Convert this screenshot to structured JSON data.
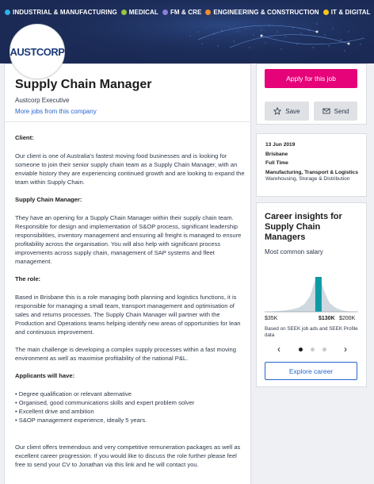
{
  "banner": {
    "sectors": [
      {
        "label": "INDUSTRIAL & MANUFACTURING",
        "color": "#2bb3e6"
      },
      {
        "label": "MEDICAL",
        "color": "#9bc53d"
      },
      {
        "label": "FM & CRE",
        "color": "#8a7fd6"
      },
      {
        "label": "ENGINEERING & CONSTRUCTION",
        "color": "#f28c28"
      },
      {
        "label": "IT & DIGITAL",
        "color": "#f7c51b"
      }
    ]
  },
  "job": {
    "logo_text": "AUSTCORP",
    "title": "Supply Chain Manager",
    "company": "Austcorp Executive",
    "more_jobs": "More jobs from this company"
  },
  "description": {
    "client_heading": "Client:",
    "client_text": "Our client is one of Australia's fastest moving food businesses and is looking for someone to join their senior supply chain team as a Supply Chain Manager, with an enviable history they are experiencing continued growth and are looking to expand the team within Supply Chain.",
    "scm_heading": "Supply Chain Manager:",
    "scm_text": "They have an opening for a Supply Chain Manager within their supply chain team.  Responsible for design and implementation of S&OP process, significant leadership responsibilities, inventory management and ensuring all freight is managed to ensure profitability across the organisation. You will also help with significant process improvements across supply chain, management of SAP systems and fleet management.",
    "role_heading": "The role:",
    "role_text_1": "Based in Brisbane this is a role managing both planning and logistics functions, it is responsible for managing a small team, transport management and optimisation of sales and returns processes. The Supply Chain Manager will partner with the Production and Operations teams helping identify new areas of opportunities for lean and continuous improvement.",
    "role_text_2": "The main challenge is developing a complex supply processes within a fast moving environment as well as maximise profitability of the national P&L.",
    "applicants_heading": "Applicants will have:",
    "bullets": [
      "• Degree qualification or relevant alternative",
      "• Organised, good communications skills and expert problem solver",
      "• Excellent drive and ambition",
      "• S&OP management experience, ideally 5 years."
    ],
    "closing_text": "Our client offers tremendous and very competitive remuneration packages as well as excellent career progression. If you would like to discuss the role further please feel free to send your CV to Jonathan via this link and he will contact you."
  },
  "actions": {
    "apply_label": "Apply for this job",
    "save_label": "Save",
    "send_label": "Send",
    "apply_color": "#e60278"
  },
  "info": {
    "date": "13 Jun 2019",
    "location": "Brisbane",
    "work_type": "Full Time",
    "classification": "Manufacturing, Transport & Logistics",
    "subclassification": "Warehousing, Storage & Distribution"
  },
  "insights": {
    "title": "Career insights for Supply Chain Managers",
    "subtitle": "Most common salary",
    "x_min": "$35K",
    "x_selected": "$130K",
    "x_max": "$200K",
    "based_on": "Based on SEEK job ads and SEEK Profile data",
    "explore_label": "Explore career",
    "page_count": 3,
    "active_page": 1,
    "highlight_color": "#0d9aa5"
  },
  "chart_data": {
    "type": "area",
    "title": "Most common salary",
    "x_range": [
      35,
      200
    ],
    "x_ticks": [
      "$35K",
      "$130K",
      "$200K"
    ],
    "x_unit": "$K",
    "highlight_x": 130,
    "series": [
      {
        "x": [
          35,
          45,
          55,
          65,
          75,
          85,
          95,
          105,
          115,
          120,
          125,
          130,
          135,
          140,
          145,
          150,
          160,
          170,
          180,
          190,
          200
        ],
        "y": [
          0,
          0.01,
          0.02,
          0.03,
          0.05,
          0.08,
          0.12,
          0.22,
          0.45,
          0.7,
          0.95,
          1.0,
          0.85,
          0.6,
          0.4,
          0.25,
          0.12,
          0.05,
          0.02,
          0.01,
          0
        ]
      }
    ]
  }
}
